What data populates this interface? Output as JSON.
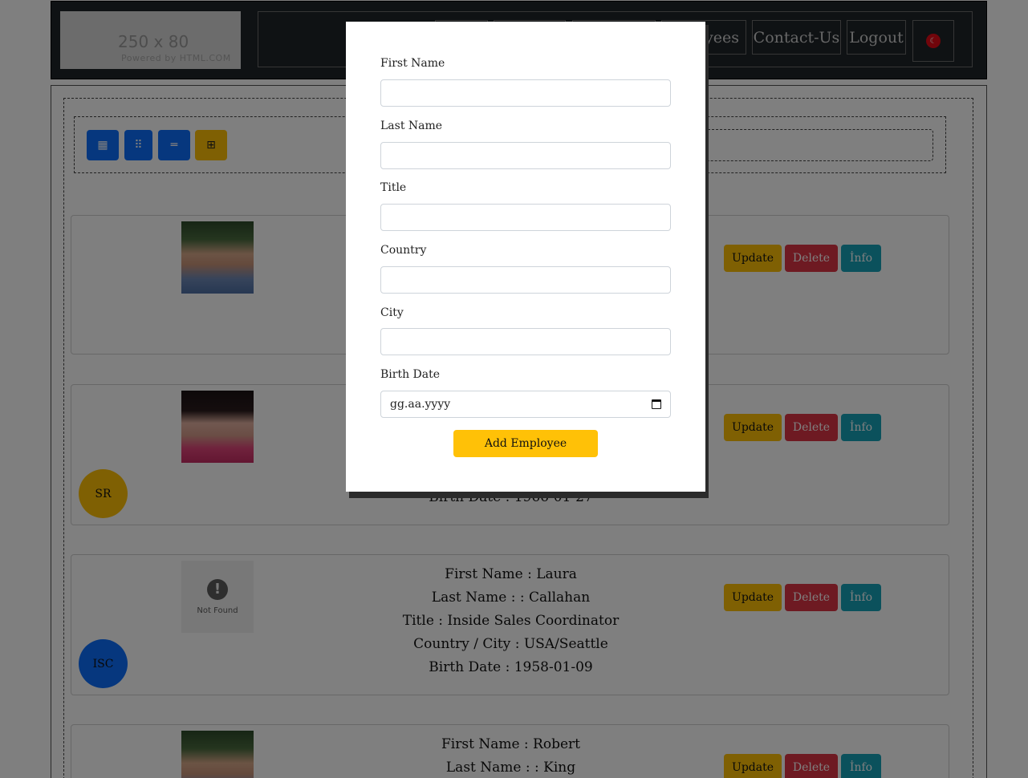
{
  "header": {
    "logo_size": "250 x 80",
    "logo_powered": "Powered by HTML.COM",
    "nav": [
      {
        "label": ""
      },
      {
        "label": ""
      },
      {
        "label": ""
      },
      {
        "label": "Employees"
      },
      {
        "label": "Contact-Us"
      },
      {
        "label": "Logout"
      }
    ],
    "flag_icon": "turkey-flag-icon"
  },
  "toolbar": {
    "buttons": [
      {
        "icon": "grid-3-icon",
        "glyph": "▦"
      },
      {
        "icon": "grid-2-icon",
        "glyph": "⠿"
      },
      {
        "icon": "list-icon",
        "glyph": "═"
      },
      {
        "icon": "add-square-icon",
        "glyph": "⊞"
      }
    ]
  },
  "employees": [
    {
      "photo": "man",
      "lines": [
        "",
        "",
        "",
        "",
        ""
      ],
      "badge": ""
    },
    {
      "photo": "woman",
      "lines": [
        "",
        "",
        "",
        "",
        "Birth Date : 1966-01-27"
      ],
      "badge": "SR"
    },
    {
      "photo": "notfound",
      "lines": [
        "First Name : Laura",
        "Last Name : : Callahan",
        "Title : Inside Sales Coordinator",
        "Country / City : USA/Seattle",
        "Birth Date : 1958-01-09"
      ],
      "badge": "ISC"
    },
    {
      "photo": "man",
      "lines": [
        "First Name : Robert",
        "Last Name : : King",
        "",
        "",
        ""
      ],
      "badge": ""
    }
  ],
  "not_found_text": "Not Found",
  "actions": {
    "update": "Update",
    "delete": "Delete",
    "info": "İnfo"
  },
  "modal": {
    "fields": [
      {
        "label": "First Name",
        "value": ""
      },
      {
        "label": "Last Name",
        "value": ""
      },
      {
        "label": "Title",
        "value": ""
      },
      {
        "label": "Country",
        "value": ""
      },
      {
        "label": "City",
        "value": ""
      },
      {
        "label": "Birth Date",
        "value": "",
        "placeholder": "gg.aa.yyyy"
      }
    ],
    "submit_label": "Add Employee"
  },
  "colors": {
    "accent": "#ffc107",
    "primary": "#0d6efd",
    "danger": "#dc3545",
    "info": "#17a2b8"
  }
}
